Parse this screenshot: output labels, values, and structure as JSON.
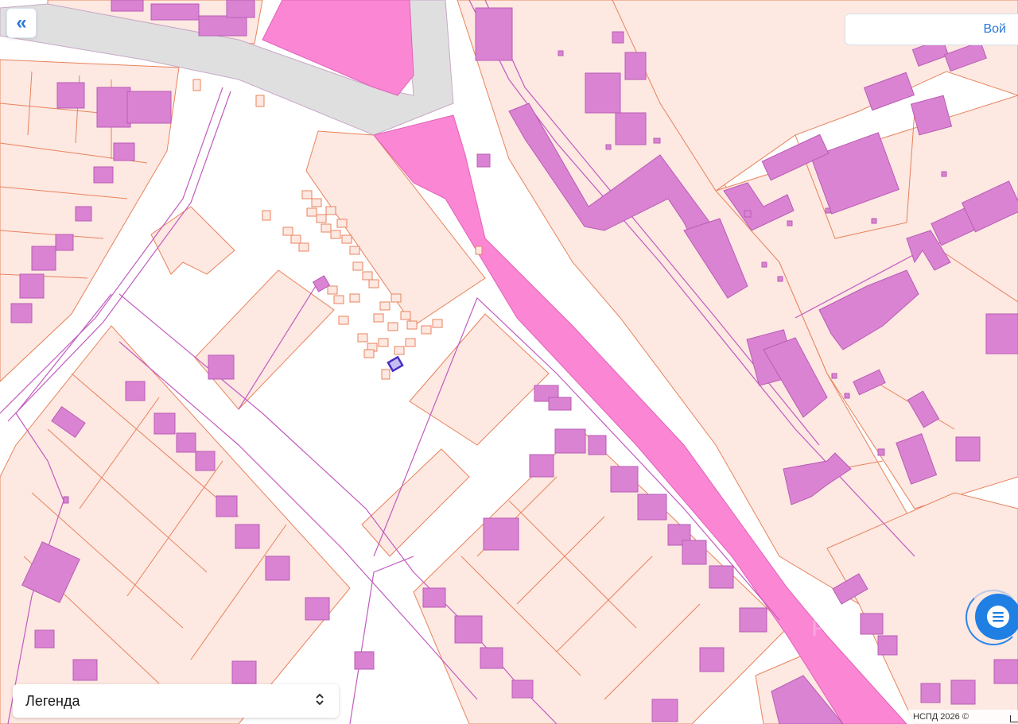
{
  "controls": {
    "collapse_label": "«",
    "login_label": "Вой",
    "legend_label": "Легенда",
    "legend_chevron": "⌃⌄"
  },
  "attribution": "НСПД 2026 ©",
  "colors": {
    "parcel_fill": "#fde8e2",
    "parcel_stroke": "#e8835c",
    "building_fill": "#db83d3",
    "road_fill": "#fb87d4",
    "road_gray": "#dfdfdf",
    "boundary": "#c25bc0",
    "selected_stroke": "#4a2fc4",
    "accent": "#2a78d6"
  },
  "icons": {
    "collapse": "double-chevron-left-icon",
    "chat": "chat-bubble-icon",
    "legend_toggle": "chevron-up-down-icon"
  }
}
